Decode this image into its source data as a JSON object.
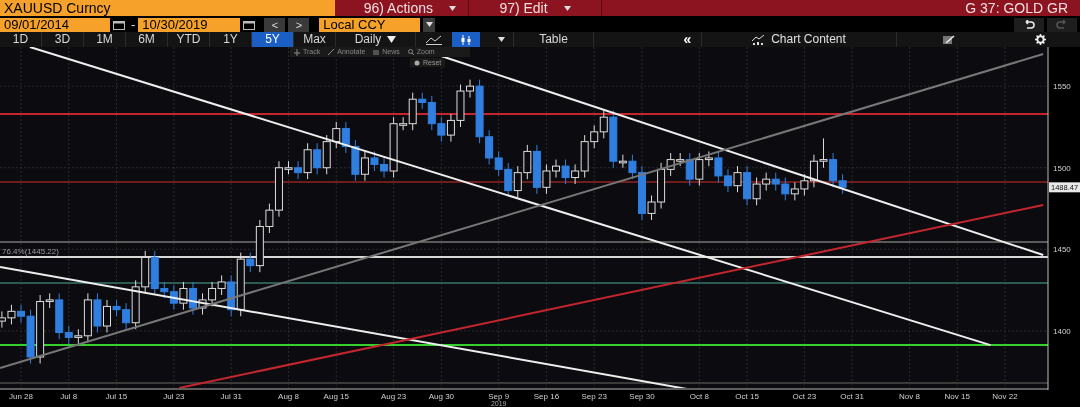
{
  "header": {
    "security": "XAUUSD Curncy",
    "menus": [
      {
        "label": "96) Actions"
      },
      {
        "label": "97) Edit"
      }
    ],
    "page_title": "G 37: GOLD GR"
  },
  "range": {
    "start": "09/01/2014",
    "separator": "-",
    "end": "10/30/2019",
    "prev": "<",
    "next": ">",
    "currency": "Local CCY"
  },
  "history": [
    {
      "kind": "undo",
      "disabled": false
    },
    {
      "kind": "redo",
      "disabled": true
    }
  ],
  "periods": [
    {
      "label": "1D",
      "selected": false
    },
    {
      "label": "3D",
      "selected": false
    },
    {
      "label": "1M",
      "selected": false
    },
    {
      "label": "6M",
      "selected": false
    },
    {
      "label": "YTD",
      "selected": false
    },
    {
      "label": "1Y",
      "selected": false
    },
    {
      "label": "5Y",
      "selected": true
    },
    {
      "label": "Max",
      "selected": false
    }
  ],
  "frequency": "Daily",
  "chart_types": [
    {
      "kind": "line",
      "selected": false
    },
    {
      "kind": "candle",
      "selected": true
    }
  ],
  "table": "Table",
  "collapse": "«",
  "chart_content": "Chart Content",
  "chart_tools": [
    {
      "kind": "track",
      "label": "Track"
    },
    {
      "kind": "annotate",
      "label": "Annotate"
    },
    {
      "kind": "news",
      "label": "News"
    },
    {
      "kind": "zoom",
      "label": "Zoom"
    }
  ],
  "reset": "Reset",
  "chart": {
    "last_price": "1488.47",
    "year_label": "2019",
    "chart_data": {
      "type": "candlestick",
      "grid": true,
      "ylim": [
        1365,
        1574
      ],
      "yticks": [
        1400,
        1450,
        1500,
        1550
      ],
      "categories": [
        null,
        null,
        "Jun 28",
        null,
        null,
        null,
        null,
        "Jul 8",
        null,
        null,
        null,
        null,
        "Jul 15",
        null,
        null,
        null,
        null,
        null,
        "Jul 23",
        null,
        null,
        null,
        null,
        null,
        "Jul 31",
        null,
        null,
        null,
        null,
        null,
        "Aug 8",
        null,
        null,
        null,
        null,
        "Aug 15",
        null,
        null,
        null,
        null,
        null,
        "Aug 23",
        null,
        null,
        null,
        null,
        "Aug 30",
        null,
        null,
        null,
        null,
        null,
        "Sep 9",
        null,
        null,
        null,
        null,
        "Sep 16",
        null,
        null,
        null,
        null,
        "Sep 23",
        null,
        null,
        null,
        null,
        "Sep 30",
        null,
        null,
        null,
        null,
        null,
        "Oct 8",
        null,
        null,
        null,
        null,
        "Oct 15",
        null,
        null,
        null,
        null,
        null,
        "Oct 23",
        null,
        null,
        null,
        null,
        "Oct 31",
        null,
        null,
        null,
        null,
        null,
        "Nov 8",
        null,
        null,
        null,
        null,
        "Nov 15",
        null,
        null,
        null,
        null,
        "Nov 22",
        null,
        null,
        null,
        null
      ],
      "ohlc": [
        [
          1406,
          1412,
          1402,
          1408
        ],
        [
          1408,
          1416,
          1404,
          1412
        ],
        [
          1412,
          1416,
          1405,
          1409
        ],
        [
          1409,
          1413,
          1380,
          1384
        ],
        [
          1384,
          1422,
          1380,
          1418
        ],
        [
          1418,
          1423,
          1414,
          1419
        ],
        [
          1419,
          1423,
          1395,
          1399
        ],
        [
          1399,
          1403,
          1392,
          1396
        ],
        [
          1396,
          1401,
          1392,
          1397
        ],
        [
          1397,
          1423,
          1393,
          1419
        ],
        [
          1419,
          1423,
          1399,
          1403
        ],
        [
          1403,
          1419,
          1399,
          1415
        ],
        [
          1415,
          1419,
          1409,
          1413
        ],
        [
          1413,
          1417,
          1401,
          1405
        ],
        [
          1405,
          1431,
          1401,
          1427
        ],
        [
          1427,
          1449,
          1423,
          1445
        ],
        [
          1445,
          1449,
          1422,
          1426
        ],
        [
          1426,
          1430,
          1420,
          1424
        ],
        [
          1424,
          1428,
          1413,
          1417
        ],
        [
          1417,
          1430,
          1413,
          1426
        ],
        [
          1426,
          1430,
          1410,
          1414
        ],
        [
          1414,
          1423,
          1410,
          1419
        ],
        [
          1419,
          1430,
          1415,
          1426
        ],
        [
          1426,
          1434,
          1422,
          1430
        ],
        [
          1430,
          1434,
          1409,
          1413
        ],
        [
          1413,
          1448,
          1409,
          1444
        ],
        [
          1444,
          1448,
          1436,
          1440
        ],
        [
          1440,
          1468,
          1436,
          1464
        ],
        [
          1464,
          1478,
          1460,
          1474
        ],
        [
          1474,
          1504,
          1470,
          1500
        ],
        [
          1499,
          1504,
          1496,
          1500
        ],
        [
          1500,
          1504,
          1493,
          1497
        ],
        [
          1497,
          1515,
          1493,
          1511
        ],
        [
          1511,
          1515,
          1496,
          1500
        ],
        [
          1500,
          1520,
          1496,
          1516
        ],
        [
          1516,
          1528,
          1512,
          1524
        ],
        [
          1524,
          1528,
          1509,
          1513
        ],
        [
          1513,
          1517,
          1492,
          1496
        ],
        [
          1496,
          1510,
          1492,
          1506
        ],
        [
          1506,
          1510,
          1498,
          1502
        ],
        [
          1502,
          1506,
          1494,
          1498
        ],
        [
          1498,
          1531,
          1494,
          1527
        ],
        [
          1526,
          1531,
          1523,
          1527
        ],
        [
          1527,
          1546,
          1523,
          1542
        ],
        [
          1542,
          1546,
          1536,
          1540
        ],
        [
          1540,
          1544,
          1523,
          1527
        ],
        [
          1527,
          1531,
          1516,
          1520
        ],
        [
          1520,
          1533,
          1516,
          1529
        ],
        [
          1529,
          1551,
          1525,
          1547
        ],
        [
          1547,
          1554,
          1543,
          1550
        ],
        [
          1550,
          1554,
          1515,
          1519
        ],
        [
          1519,
          1523,
          1502,
          1506
        ],
        [
          1506,
          1510,
          1495,
          1499
        ],
        [
          1499,
          1503,
          1482,
          1486
        ],
        [
          1486,
          1501,
          1482,
          1497
        ],
        [
          1497,
          1514,
          1493,
          1510
        ],
        [
          1510,
          1514,
          1484,
          1488
        ],
        [
          1488,
          1502,
          1484,
          1498
        ],
        [
          1498,
          1505,
          1494,
          1501
        ],
        [
          1501,
          1505,
          1490,
          1494
        ],
        [
          1494,
          1502,
          1490,
          1498
        ],
        [
          1498,
          1520,
          1494,
          1516
        ],
        [
          1516,
          1526,
          1512,
          1522
        ],
        [
          1522,
          1535,
          1518,
          1531
        ],
        [
          1531,
          1535,
          1500,
          1504
        ],
        [
          1503,
          1508,
          1500,
          1504
        ],
        [
          1504,
          1508,
          1493,
          1497
        ],
        [
          1497,
          1501,
          1468,
          1472
        ],
        [
          1472,
          1483,
          1468,
          1479
        ],
        [
          1479,
          1503,
          1475,
          1499
        ],
        [
          1499,
          1509,
          1495,
          1505
        ],
        [
          1504,
          1509,
          1501,
          1505
        ],
        [
          1505,
          1509,
          1489,
          1493
        ],
        [
          1493,
          1509,
          1489,
          1505
        ],
        [
          1505,
          1510,
          1501,
          1506
        ],
        [
          1506,
          1510,
          1491,
          1495
        ],
        [
          1495,
          1499,
          1485,
          1489
        ],
        [
          1489,
          1501,
          1485,
          1497
        ],
        [
          1497,
          1501,
          1477,
          1481
        ],
        [
          1481,
          1494,
          1477,
          1490
        ],
        [
          1490,
          1497,
          1486,
          1493
        ],
        [
          1493,
          1497,
          1486,
          1490
        ],
        [
          1490,
          1494,
          1480,
          1484
        ],
        [
          1484,
          1491,
          1480,
          1487
        ],
        [
          1487,
          1496,
          1483,
          1492
        ],
        [
          1492,
          1508,
          1488,
          1504
        ],
        [
          1504,
          1518,
          1500,
          1505
        ],
        [
          1505,
          1509,
          1488,
          1492
        ],
        [
          1492,
          1496,
          1484,
          1488
        ],
        null,
        null,
        null,
        null,
        null,
        null,
        null,
        null,
        null,
        null,
        null,
        null,
        null,
        null,
        null,
        null,
        null,
        null,
        null,
        null,
        null
      ],
      "ref_lines": [
        {
          "axis": "y",
          "value": 1533,
          "color": "#c4262e"
        },
        {
          "axis": "y",
          "value": 1491.3,
          "color": "#6e1c1c"
        },
        {
          "axis": "y",
          "value": 1454.5,
          "color": "#5a5a5a"
        },
        {
          "axis": "y",
          "value": 1445.22,
          "color": "#d8d8d8",
          "label": "76.4%(1445.22)"
        },
        {
          "axis": "y",
          "value": 1429.3,
          "color": "#2d5a52"
        },
        {
          "axis": "y",
          "value": 1391.3,
          "color": "#36d02e"
        },
        {
          "axis": "y",
          "value": 1368,
          "color": "#3a3a3a"
        }
      ]
    }
  }
}
